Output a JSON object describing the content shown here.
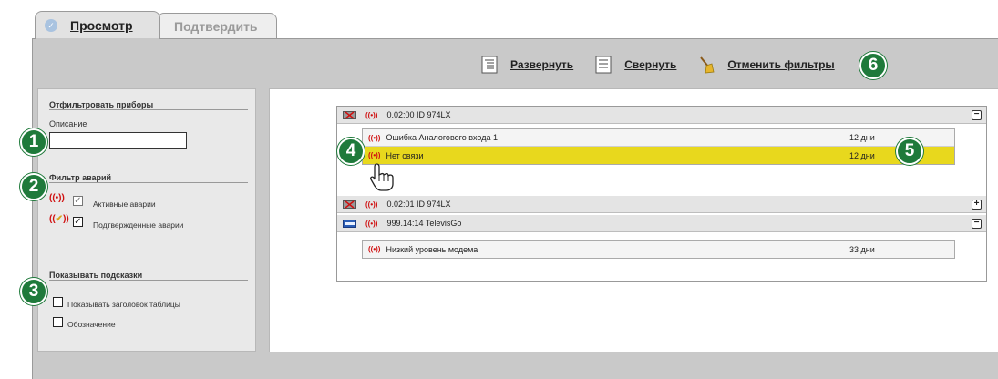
{
  "tabs": [
    {
      "label": "Просмотр",
      "active": true
    },
    {
      "label": "Подтвердить",
      "active": false
    }
  ],
  "toolbar": {
    "expand_label": "Развернуть",
    "collapse_label": "Свернуть",
    "clear_filters_label": "Отменить фильтры"
  },
  "filter": {
    "section_title": "Отфильтровать приборы",
    "description_label": "Описание",
    "description_value": ""
  },
  "alarm_filter": {
    "section_title": "Фильтр аварий",
    "active_label": "Активные аварии",
    "active_checked": true,
    "acknowledged_label": "Подтвержденные аварии",
    "acknowledged_checked": true
  },
  "hints": {
    "section_title": "Показывать подсказки",
    "show_header_label": "Показывать заголовок таблицы",
    "show_header_checked": false,
    "legend_label": "Обозначение",
    "legend_checked": false
  },
  "badges": [
    "1",
    "2",
    "3",
    "4",
    "5",
    "6"
  ],
  "devices": [
    {
      "name": "0.02:00  ID 974LX",
      "toggle": "−",
      "alarms": [
        {
          "text": "Ошибка Аналогового входа 1",
          "days": "12 дни",
          "highlighted": false
        },
        {
          "text": "Нет связи",
          "days": "12 дни",
          "highlighted": true
        }
      ]
    },
    {
      "name": "0.02:01  ID 974LX",
      "toggle": "+",
      "alarms": []
    },
    {
      "name": "999.14:14 TelevisGo",
      "toggle": "−",
      "alarms": [
        {
          "text": "Низкий уровень модема",
          "days": "33 дни",
          "highlighted": false
        }
      ]
    }
  ],
  "colors": {
    "badge": "#1f7a3b",
    "highlight": "#e8d81d",
    "alarm_signal": "#d01010"
  }
}
